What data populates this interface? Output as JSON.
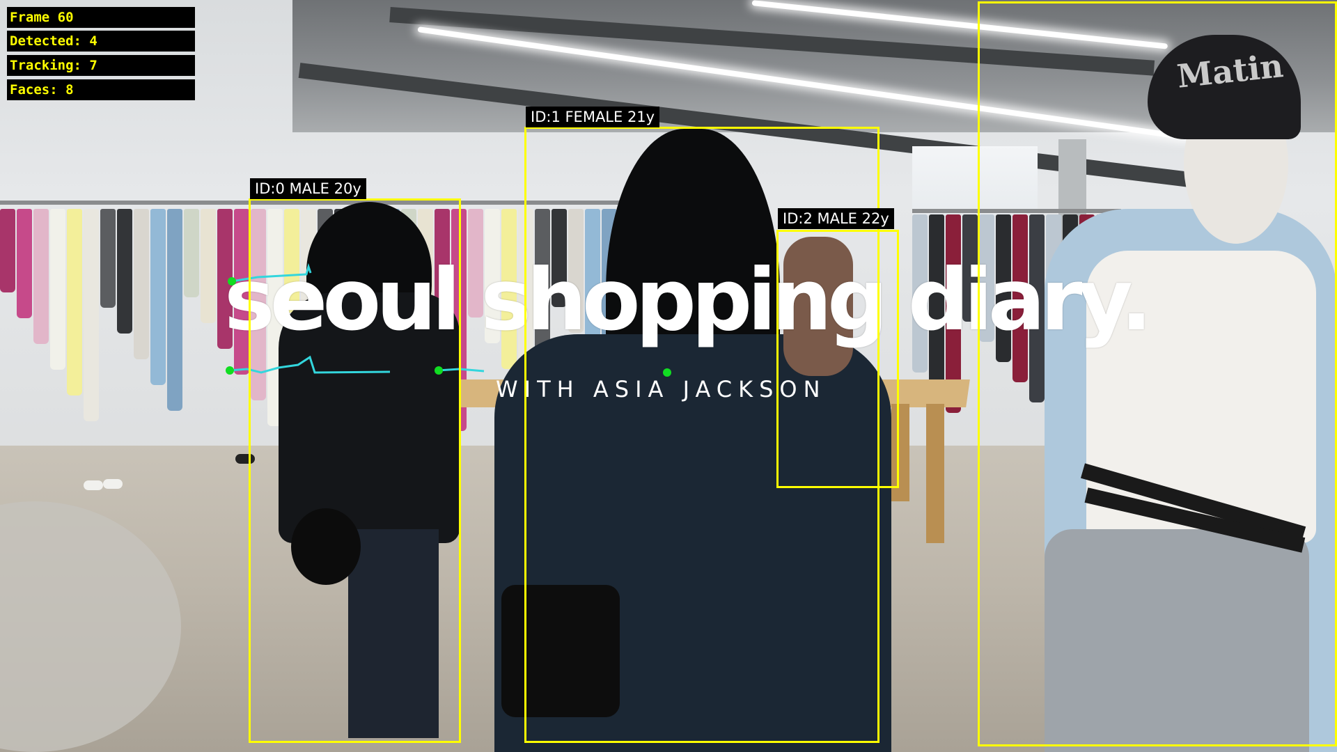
{
  "hud": {
    "frame": "Frame 60",
    "detected": "Detected: 4",
    "tracking": "Tracking: 7",
    "faces": "Faces: 8"
  },
  "detections": [
    {
      "label": "ID:0 MALE 20y"
    },
    {
      "label": "ID:1 FEMALE 21y"
    },
    {
      "label": "ID:2 MALE 22y"
    },
    {
      "label": ""
    }
  ],
  "overlay": {
    "title": "seoul shopping diary.",
    "subtitle": "WITH ASIA JACKSON"
  },
  "scene": {
    "cap_text": "Matin"
  },
  "colors": {
    "box": "#ffff00",
    "track_line": "#33d6dd",
    "track_point": "#11dd22",
    "hud_text": "#ffff00"
  }
}
